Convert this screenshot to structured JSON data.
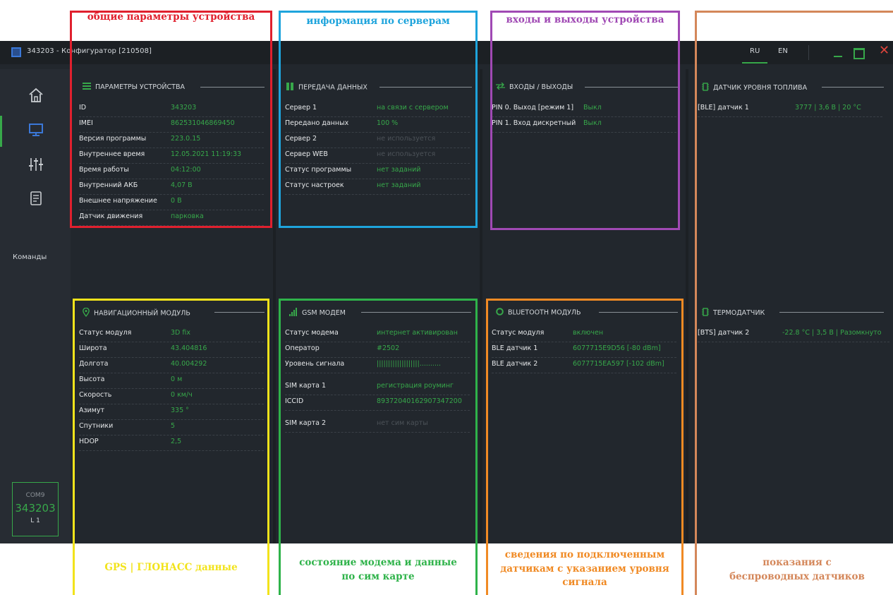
{
  "app": {
    "title": "343203 - Конфигуратор [210508]",
    "lang_ru": "RU",
    "lang_en": "EN",
    "close_glyph": "✕"
  },
  "sidebar": {
    "commands_label": "Команды",
    "com_port": "COM9",
    "device_id": "343203",
    "level": "L 1"
  },
  "device_params": {
    "title": "ПАРАМЕТРЫ УСТРОЙСТВА",
    "rows": [
      {
        "k": "ID",
        "v": "343203"
      },
      {
        "k": "IMEI",
        "v": "862531046869450"
      },
      {
        "k": "Версия программы",
        "v": "223.0.15"
      },
      {
        "k": "Внутреннее время",
        "v": "12.05.2021 11:19:33"
      },
      {
        "k": "Время работы",
        "v": "04:12:00"
      },
      {
        "k": "Внутренний АКБ",
        "v": "4,07 В"
      },
      {
        "k": "Внешнее напряжение",
        "v": "0 В"
      },
      {
        "k": "Датчик движения",
        "v": "парковка"
      }
    ]
  },
  "data_transfer": {
    "title": "ПЕРЕДАЧА ДАННЫХ",
    "rows": [
      {
        "k": "Сервер 1",
        "v": "на связи с сервером"
      },
      {
        "k": "Передано данных",
        "v": "100 %"
      },
      {
        "k": "Сервер 2",
        "v": "не используется"
      },
      {
        "k": "Сервер WEB",
        "v": "не используется"
      },
      {
        "k": "Статус программы",
        "v": "нет заданий"
      },
      {
        "k": "Статус настроек",
        "v": "нет заданий"
      }
    ]
  },
  "io": {
    "title": "ВХОДЫ / ВЫХОДЫ",
    "rows": [
      {
        "k": "PIN 0. Выход [режим 1]",
        "v": "Выкл"
      },
      {
        "k": "PIN 1. Вход дискретный",
        "v": "Выкл"
      }
    ]
  },
  "fuel": {
    "title": "ДАТЧИК УРОВНЯ ТОПЛИВА",
    "rows": [
      {
        "k": "[BLE] датчик 1",
        "v": "3777 | 3,6 В | 20 °C"
      }
    ]
  },
  "nav": {
    "title": "НАВИГАЦИОННЫЙ МОДУЛЬ",
    "rows": [
      {
        "k": "Статус модуля",
        "v": "3D fix"
      },
      {
        "k": "Широта",
        "v": "43.404816"
      },
      {
        "k": "Долгота",
        "v": "40.004292"
      },
      {
        "k": "Высота",
        "v": "0 м"
      },
      {
        "k": "Скорость",
        "v": "0 км/ч"
      },
      {
        "k": "Азимут",
        "v": "335 °"
      },
      {
        "k": "Спутники",
        "v": "5"
      },
      {
        "k": "HDOP",
        "v": "2,5"
      }
    ]
  },
  "gsm": {
    "title": "GSM МОДЕМ",
    "rows": [
      {
        "k": "Статус модема",
        "v": "интернет активирован"
      },
      {
        "k": "Оператор",
        "v": "#2502"
      },
      {
        "k": "Уровень сигнала",
        "v": "|||||||||||||||||||.........."
      },
      {
        "k": "SIM карта 1",
        "v": "регистрация роуминг"
      },
      {
        "k": "ICCID",
        "v": "89372040162907347200"
      },
      {
        "k": "SIM карта 2",
        "v": "нет сим карты"
      }
    ]
  },
  "bt": {
    "title": "BLUETOOTH МОДУЛЬ",
    "rows": [
      {
        "k": "Статус модуля",
        "v": "включен"
      },
      {
        "k": "BLE датчик 1",
        "v": "6077715E9D56 [-80 dBm]"
      },
      {
        "k": "BLE датчик 2",
        "v": "6077715EA597 [-102 dBm]"
      }
    ]
  },
  "thermo": {
    "title": "ТЕРМОДАТЧИК",
    "rows": [
      {
        "k": "[BTS] датчик 2",
        "v": "-22.8 °C | 3,5 В | Разомкнуто"
      }
    ]
  },
  "annotations": {
    "general": "общие параметры устройства",
    "servers": "информация по серверам",
    "io": "входы и выходы устройства",
    "gps": "GPS | ГЛОНАСС данные",
    "modem_l1": "состояние модема и данные",
    "modem_l2": "по сим карте",
    "sensors_l1": "сведения по подключенным",
    "sensors_l2": "датчикам с указанием уровня",
    "sensors_l3": "сигнала",
    "wireless_l1": "показания с",
    "wireless_l2": "беспроводных датчиков"
  },
  "colors": {
    "accent_green": "#37a84a",
    "window_bg": "#22272d",
    "close_red": "#e0453c",
    "ann_red": "#e0202e",
    "ann_blue": "#1ea4dc",
    "ann_purple": "#a049b4",
    "ann_orange": "#d4875a",
    "ann_yellow": "#f2e31b",
    "ann_green": "#2fb34a",
    "ann_orange2": "#f08a24"
  },
  "icons": [
    "monitor-icon",
    "home-icon",
    "sliders-icon",
    "list-icon",
    "bars-icon",
    "arrows-icon",
    "chip-icon",
    "pin-icon",
    "signal-icon",
    "ring-icon",
    "minimize-icon",
    "maximize-icon",
    "close-icon"
  ]
}
